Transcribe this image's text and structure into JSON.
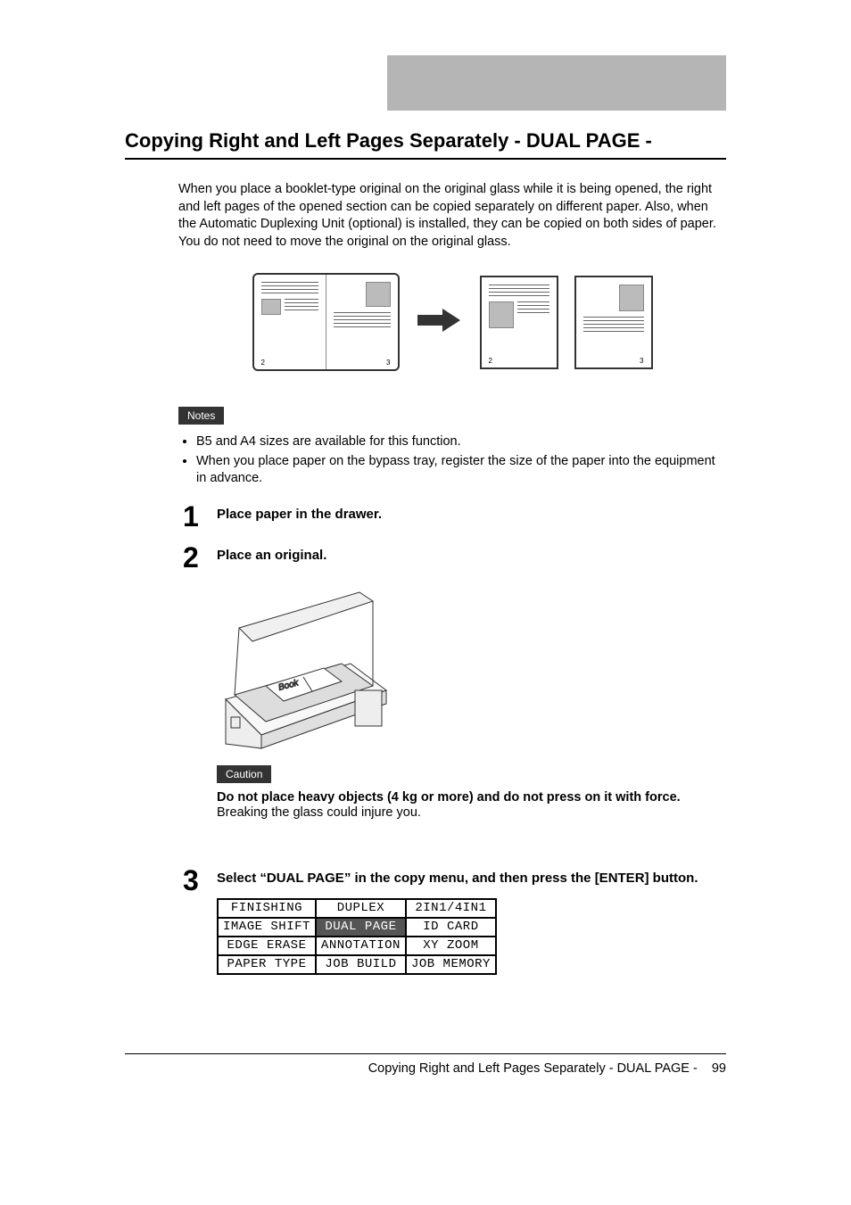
{
  "section_title": "Copying Right and Left Pages Separately - DUAL PAGE -",
  "intro": "When you place a booklet-type original on the original glass while it is being opened, the right and left pages of the opened section can be copied separately on different paper. Also, when the Automatic Duplexing Unit (optional) is installed, they can be copied on both sides of paper. You do not need to move the original on the original glass.",
  "diagram": {
    "book_left_num": "2",
    "book_right_num": "3",
    "result_left_num": "2",
    "result_right_num": "3"
  },
  "notes_label": "Notes",
  "notes": [
    "B5 and A4 sizes are available for this function.",
    "When you place paper on the bypass tray, register the size of the paper into the equipment in advance."
  ],
  "steps": {
    "s1": {
      "num": "1",
      "title": "Place paper in the drawer."
    },
    "s2": {
      "num": "2",
      "title": "Place an original."
    },
    "s3": {
      "num": "3",
      "title": "Select “DUAL PAGE” in the copy menu, and then press the [ENTER] button."
    }
  },
  "caution_label": "Caution",
  "caution_bold": "Do not place heavy objects (4 kg or more) and do not press on it with force.",
  "caution_text": "Breaking the glass could injure you.",
  "menu": {
    "r1": [
      "FINISHING",
      "DUPLEX",
      "2IN1/4IN1"
    ],
    "r2": [
      "IMAGE SHIFT",
      "DUAL PAGE",
      "ID CARD"
    ],
    "r3": [
      "EDGE ERASE",
      "ANNOTATION",
      "XY ZOOM"
    ],
    "r4": [
      "PAPER TYPE",
      "JOB BUILD",
      "JOB MEMORY"
    ]
  },
  "footer_text": "Copying Right and Left Pages Separately - DUAL PAGE -",
  "footer_page": "99"
}
